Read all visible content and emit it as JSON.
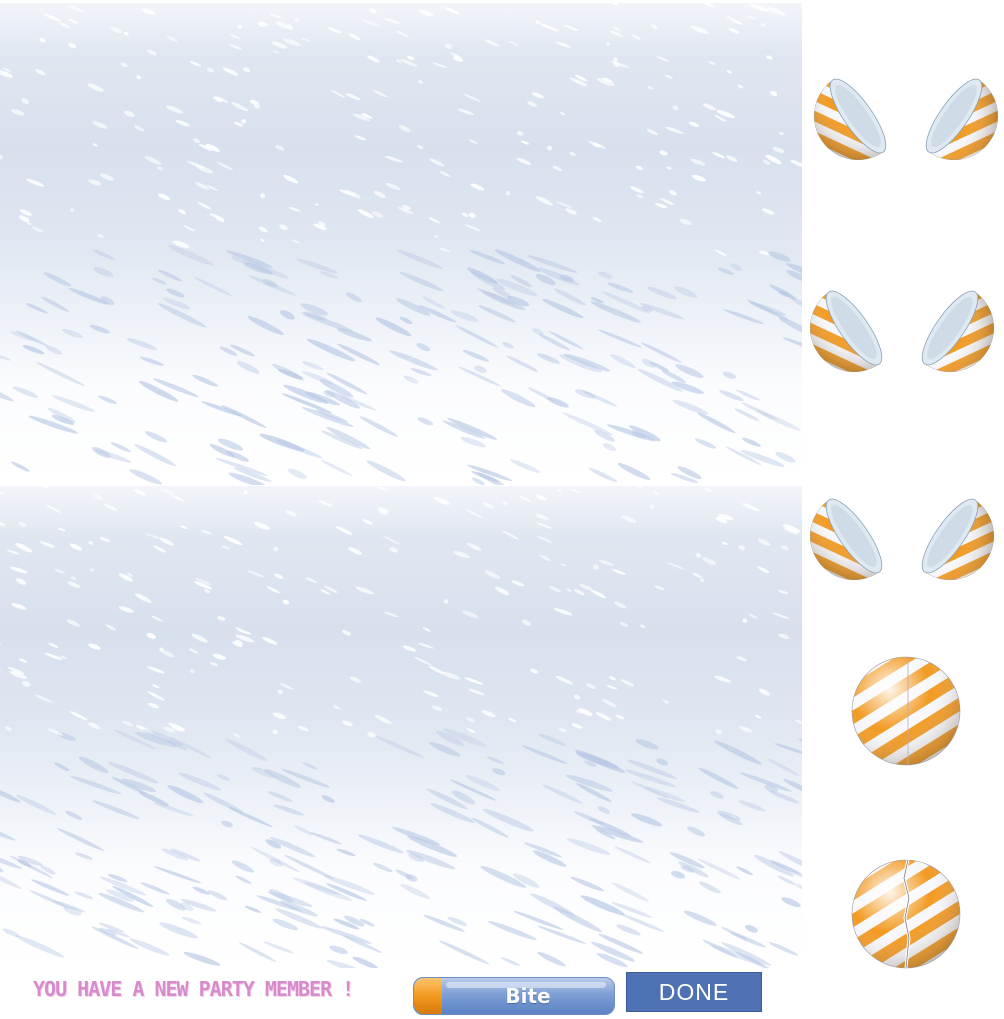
{
  "game": {
    "message": "YOU HAVE A NEW PARTY MEMBER !",
    "actions": {
      "bite_label": "Bite",
      "done_label": "DONE"
    },
    "colors": {
      "stripe": "#f29a22",
      "button_blue": "#4d71b2",
      "message_pink": "#d88bcb"
    },
    "sprite_frames": [
      "capsule-open",
      "capsule-open",
      "capsule-open",
      "capsule-closed",
      "capsule-cracked"
    ]
  }
}
